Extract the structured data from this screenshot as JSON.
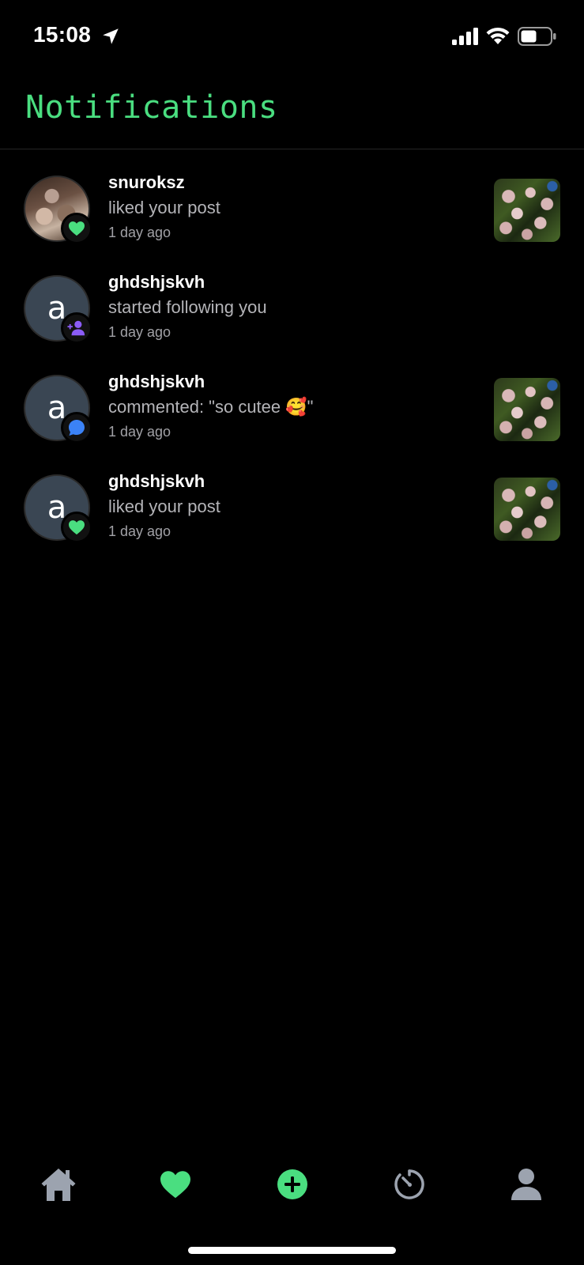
{
  "status_bar": {
    "time": "15:08"
  },
  "header": {
    "title": "Notifications"
  },
  "colors": {
    "accent": "#4ade80",
    "follow_badge": "#8b5cf6",
    "comment_badge": "#3b82f6",
    "icon_gray": "#9ca3af"
  },
  "notifications": [
    {
      "username": "snuroksz",
      "action": "liked your post",
      "time": "1 day ago",
      "avatar_type": "photo",
      "avatar_letter": "",
      "badge": "heart-icon",
      "has_thumbnail": true
    },
    {
      "username": "ghdshjskvh",
      "action": "started following you",
      "time": "1 day ago",
      "avatar_type": "letter",
      "avatar_letter": "a",
      "badge": "add-user-icon",
      "has_thumbnail": false
    },
    {
      "username": "ghdshjskvh",
      "action": "commented: \"so cutee 🥰\"",
      "time": "1 day ago",
      "avatar_type": "letter",
      "avatar_letter": "a",
      "badge": "comment-icon",
      "has_thumbnail": true
    },
    {
      "username": "ghdshjskvh",
      "action": "liked your post",
      "time": "1 day ago",
      "avatar_type": "letter",
      "avatar_letter": "a",
      "badge": "heart-icon",
      "has_thumbnail": true
    }
  ],
  "tab_bar": {
    "tabs": [
      {
        "icon": "home-icon",
        "active": false
      },
      {
        "icon": "heart-icon",
        "active": true
      },
      {
        "icon": "add-circle-icon",
        "active": false
      },
      {
        "icon": "timer-icon",
        "active": false
      },
      {
        "icon": "profile-icon",
        "active": false
      }
    ]
  }
}
